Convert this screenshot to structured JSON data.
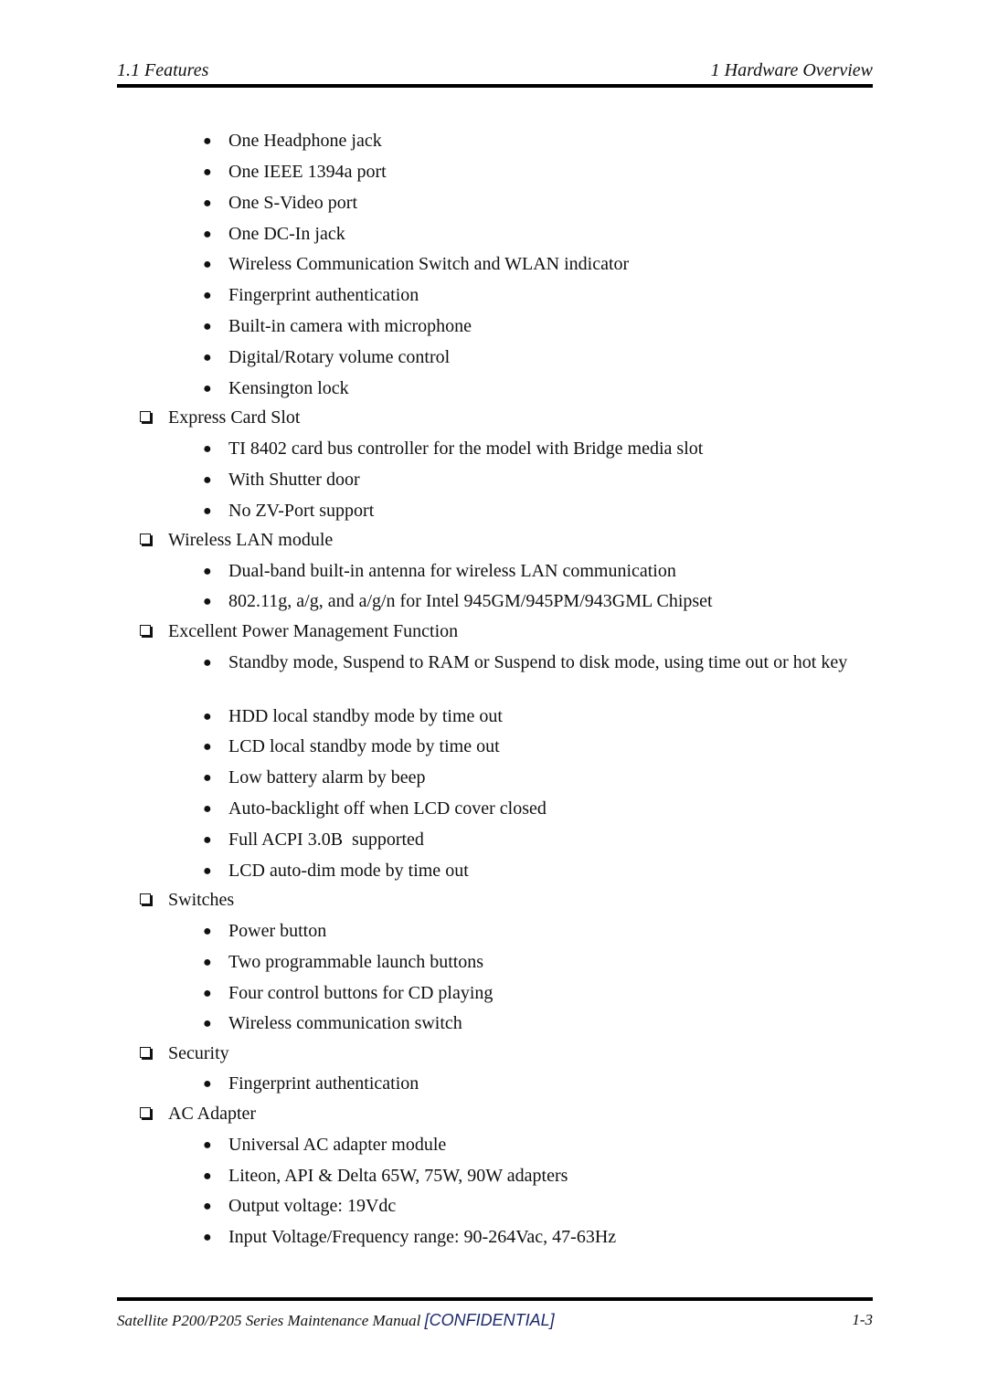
{
  "header": {
    "section": "1.1  Features",
    "chapter": "1  Hardware Overview"
  },
  "content": [
    {
      "type": "bullet",
      "text": "One Headphone jack"
    },
    {
      "type": "bullet",
      "text": "One IEEE 1394a port"
    },
    {
      "type": "bullet",
      "text": "One S-Video port"
    },
    {
      "type": "bullet",
      "text": "One DC-In jack"
    },
    {
      "type": "bullet",
      "text": "Wireless Communication Switch and WLAN indicator"
    },
    {
      "type": "bullet",
      "text": "Fingerprint authentication"
    },
    {
      "type": "bullet",
      "text": "Built-in camera with microphone"
    },
    {
      "type": "bullet",
      "text": "Digital/Rotary volume control"
    },
    {
      "type": "bullet",
      "text": "Kensington lock"
    },
    {
      "type": "section",
      "text": "Express Card Slot"
    },
    {
      "type": "bullet",
      "text": "TI 8402 card bus controller for the model with Bridge media slot"
    },
    {
      "type": "bullet",
      "text": "With Shutter door"
    },
    {
      "type": "bullet",
      "text": "No ZV-Port support"
    },
    {
      "type": "section",
      "text": "Wireless LAN module"
    },
    {
      "type": "bullet",
      "text": "Dual-band built-in antenna for wireless LAN communication"
    },
    {
      "type": "bullet",
      "text": "802.11g, a/g, and a/g/n for Intel 945GM/945PM/943GML Chipset"
    },
    {
      "type": "section",
      "text": "Excellent Power Management Function"
    },
    {
      "type": "bullet",
      "text": "Standby mode, Suspend to RAM or Suspend to disk mode, using time out or hot key"
    },
    {
      "type": "bullet",
      "text": "HDD local standby mode by time out"
    },
    {
      "type": "bullet",
      "text": "LCD local standby mode by time out"
    },
    {
      "type": "bullet",
      "text": "Low battery alarm by beep"
    },
    {
      "type": "bullet",
      "text": "Auto-backlight off when LCD cover closed"
    },
    {
      "type": "bullet",
      "text": "Full ACPI 3.0B  supported"
    },
    {
      "type": "bullet",
      "text": "LCD auto-dim mode by time out"
    },
    {
      "type": "section",
      "text": "Switches"
    },
    {
      "type": "bullet",
      "text": "Power button"
    },
    {
      "type": "bullet",
      "text": "Two programmable launch buttons"
    },
    {
      "type": "bullet",
      "text": "Four control buttons for CD playing"
    },
    {
      "type": "bullet",
      "text": "Wireless communication switch"
    },
    {
      "type": "section",
      "text": "Security"
    },
    {
      "type": "bullet",
      "text": "Fingerprint authentication"
    },
    {
      "type": "section",
      "text": "AC Adapter"
    },
    {
      "type": "bullet",
      "text": "Universal AC adapter module"
    },
    {
      "type": "bullet",
      "text": "Liteon, API & Delta 65W, 75W, 90W adapters"
    },
    {
      "type": "bullet",
      "text": "Output voltage: 19Vdc"
    },
    {
      "type": "bullet",
      "text": "Input Voltage/Frequency range: 90-264Vac, 47-63Hz"
    }
  ],
  "footer": {
    "title": "Satellite P200/P205 Series Maintenance Manual ",
    "confidential": "[CONFIDENTIAL]",
    "page_number": "1-3"
  },
  "colors": {
    "text": "#111111",
    "confidential": "#1b2a6b"
  }
}
